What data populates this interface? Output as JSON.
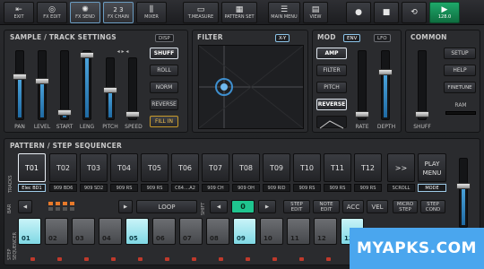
{
  "topbar": {
    "buttons": [
      {
        "label": "EXIT",
        "icon": "exit-icon"
      },
      {
        "label": "FX EDIT",
        "icon": "dial-icon"
      },
      {
        "label": "FX SEND",
        "icon": "fx-send-icon"
      },
      {
        "label": "FX CHAIN",
        "icon": "fx-chain-icon",
        "glyph": "2 3"
      },
      {
        "label": "MIXER",
        "icon": "mixer-icon"
      },
      {
        "label": "T.MEASURE",
        "icon": "measure-icon"
      },
      {
        "label": "PATTERN SET",
        "icon": "pattern-set-icon"
      },
      {
        "label": "MAIN MENU",
        "icon": "main-menu-icon"
      },
      {
        "label": "VIEW",
        "icon": "view-icon"
      }
    ],
    "play_value": "128.0"
  },
  "sample": {
    "title": "SAMPLE / TRACK SETTINGS",
    "disp": "DISP",
    "slider_labels": [
      "PAN",
      "LEVEL",
      "START",
      "LENG",
      "PITCH",
      "SPEED"
    ],
    "slider_levels": [
      0.62,
      0.55,
      0.1,
      0.95,
      0.45,
      0.05
    ],
    "buttons": [
      "SHUFF",
      "ROLL",
      "NORM",
      "REVERSE",
      "FILL IN"
    ]
  },
  "filter": {
    "title": "FILTER",
    "tag": "X-Y"
  },
  "mod": {
    "title": "MOD",
    "tags": [
      "ENV",
      "LFO"
    ],
    "buttons": [
      "AMP",
      "FILTER",
      "PITCH",
      "REVERSE"
    ],
    "slider_labels": [
      "RATE",
      "DEPTH"
    ],
    "slider_levels": [
      0.05,
      0.7
    ]
  },
  "common": {
    "title": "COMMON",
    "buttons": [
      "SETUP",
      "HELP",
      "FINETUNE"
    ],
    "shuff_label": "SHUFF",
    "ram_label": "RAM",
    "slider_level": 0.05
  },
  "pattern": {
    "title": "PATTERN / STEP SEQUENCER",
    "tracks_side": "TRACKS",
    "tracks": [
      "T01",
      "T02",
      "T03",
      "T04",
      "T05",
      "T06",
      "T07",
      "T08",
      "T09",
      "T10",
      "T11",
      "T12"
    ],
    "track_labels": [
      "Elec BD1",
      "909 BD6",
      "909 SD2",
      "909 RS",
      "909 RS",
      "C64....A2",
      "909 CH",
      "909 OH",
      "909 RID",
      "909 RS",
      "909 RS",
      "909 RS"
    ],
    "next": ">>",
    "scroll": "SCROLL",
    "play_menu": "PLAY MENU",
    "mode": "MODE"
  },
  "seq": {
    "side": "STEP SEQUENCER",
    "bar": "BAR",
    "loop": "LOOP",
    "shift": "SHIFT",
    "shift_value": "0",
    "controls": [
      "STEP EDIT",
      "NOTE EDIT",
      "ACC",
      "VEL",
      "MICRO STEP",
      "STEP COND"
    ],
    "steps": [
      "01",
      "02",
      "03",
      "04",
      "05",
      "06",
      "07",
      "08",
      "09",
      "10",
      "11",
      "12",
      "13"
    ],
    "active_steps": [
      0,
      4,
      8,
      12
    ]
  },
  "watermark": "MYAPKS.COM"
}
